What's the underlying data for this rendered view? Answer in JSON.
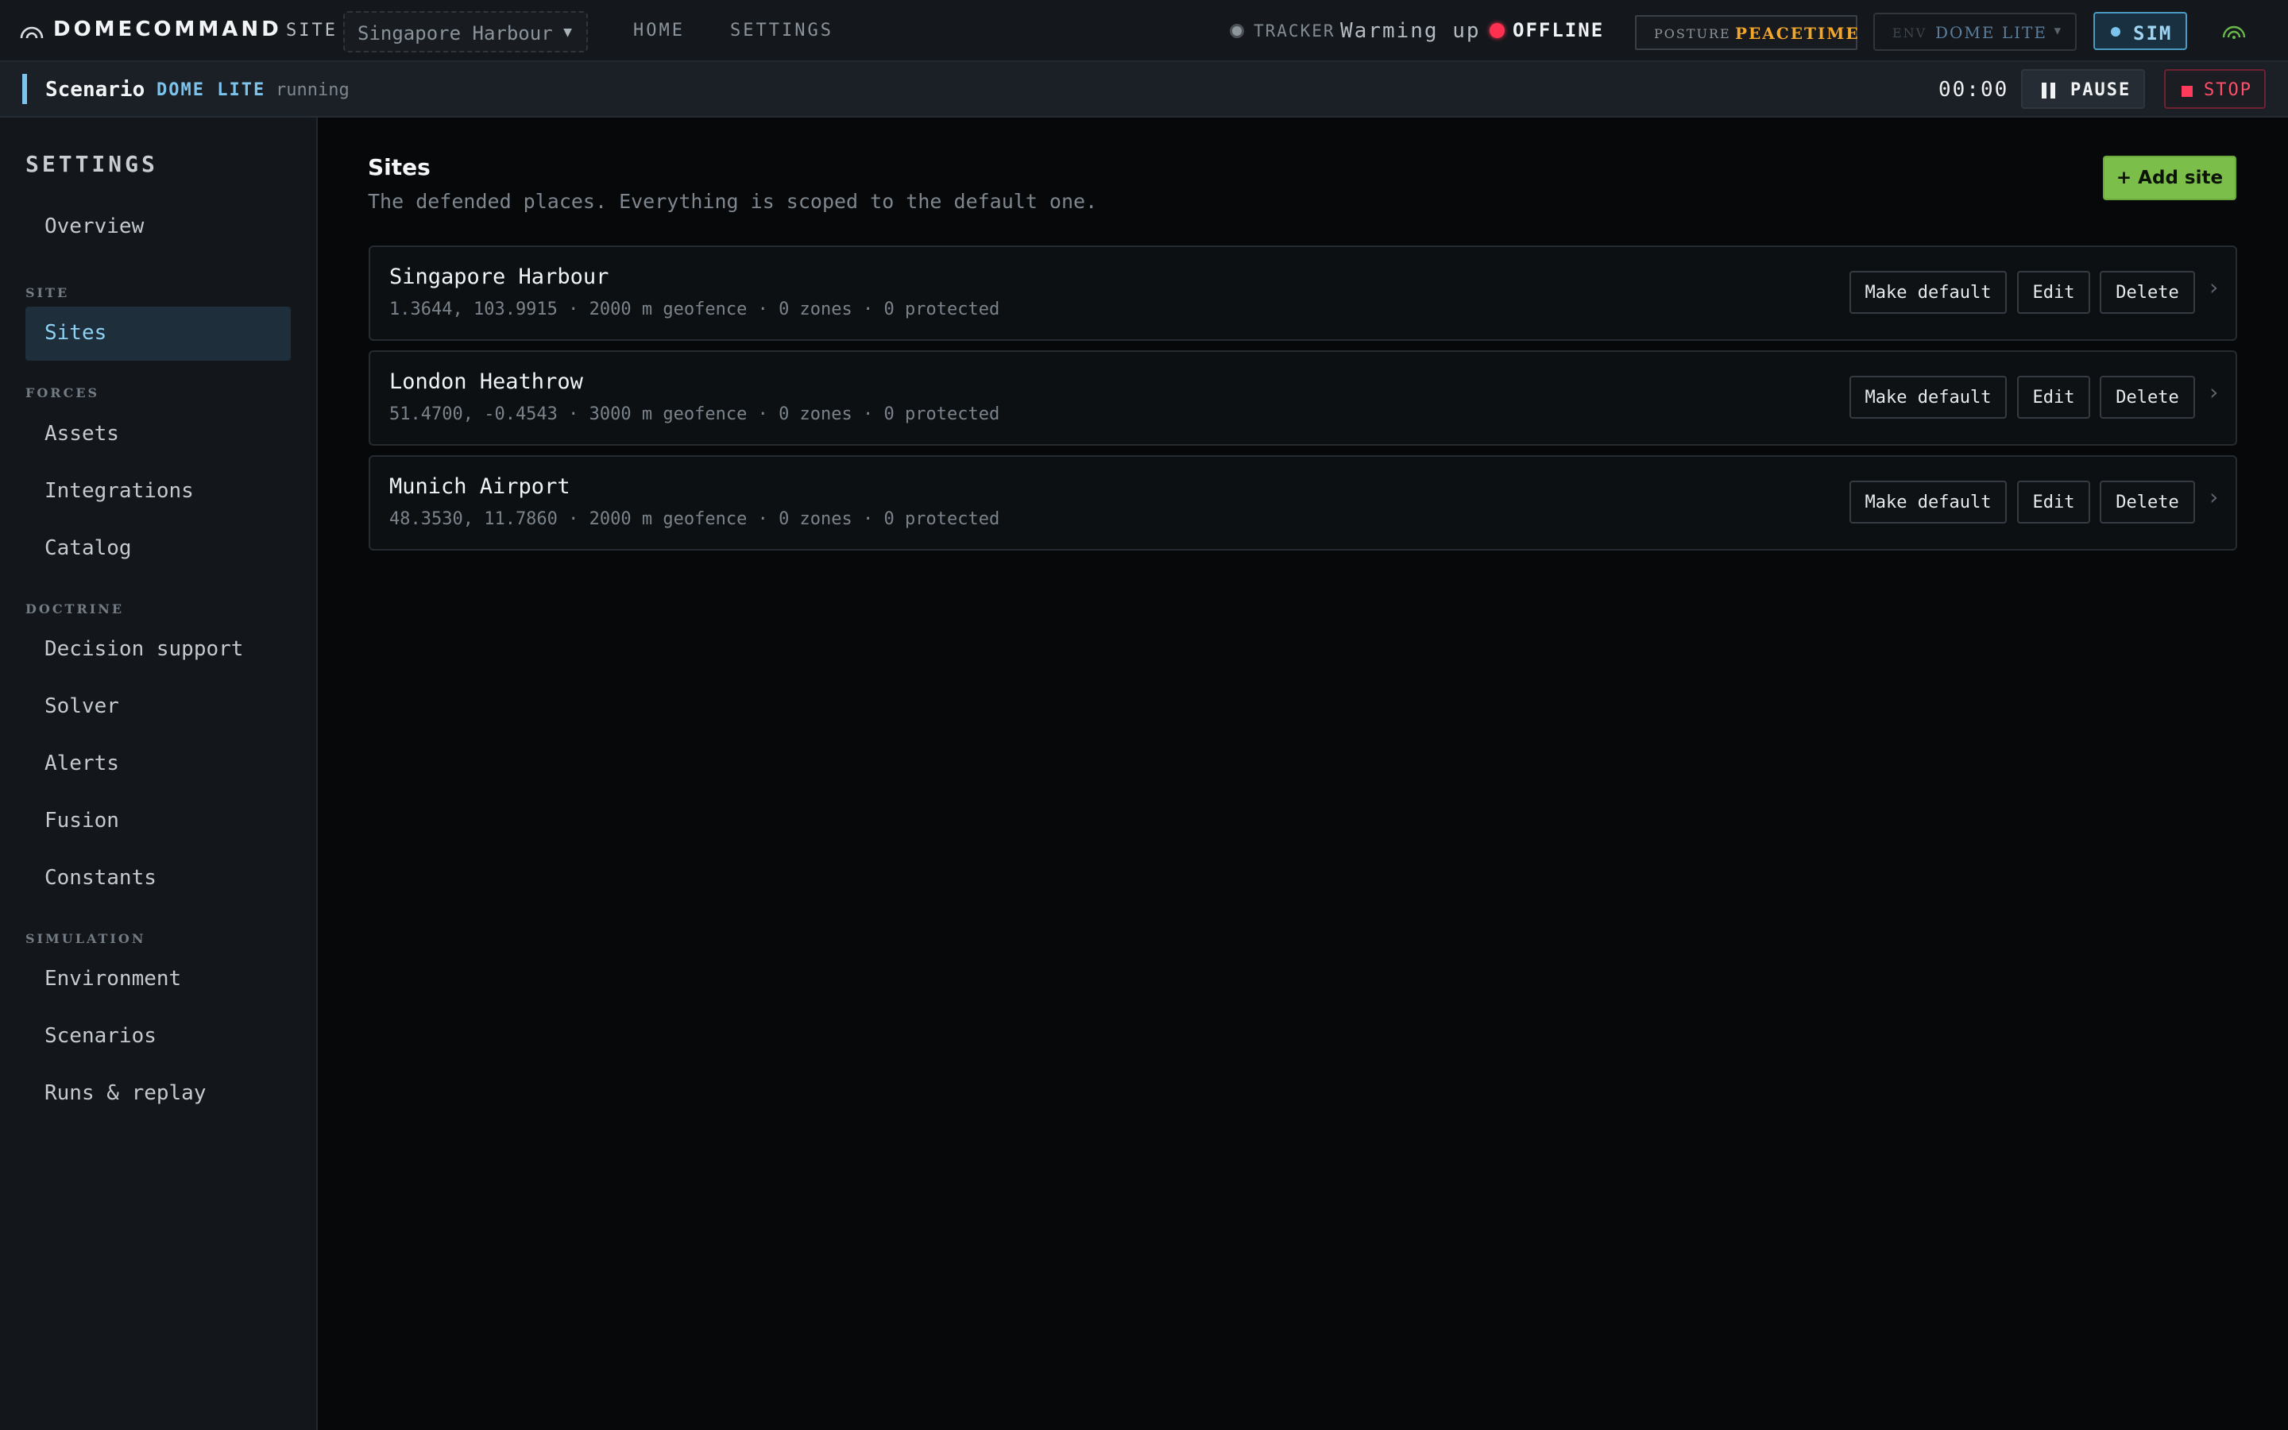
{
  "app": {
    "name": "DOMECOMMAND"
  },
  "topbar": {
    "site_label": "SITE",
    "site_select": {
      "value": "Singapore Harbour"
    },
    "nav": [
      "HOME",
      "SETTINGS"
    ],
    "tracker": {
      "label": "TRACKER",
      "status": "Warming up"
    },
    "connection": {
      "label": "OFFLINE",
      "color": "#ff3050"
    },
    "posture": {
      "label": "POSTURE",
      "value": "PEACETIME",
      "color": "#f2a72b"
    },
    "env": {
      "label": "ENV",
      "value": "DOME LITE"
    },
    "sim": {
      "label": "SIM",
      "color": "#7cc4ee"
    }
  },
  "scenario": {
    "title": "Scenario",
    "env": "DOME LITE",
    "state": "running",
    "timer": "00:00",
    "pause_label": "PAUSE",
    "stop_label": "STOP"
  },
  "sidebar": {
    "title": "SETTINGS",
    "overview": "Overview",
    "groups": {
      "site": {
        "label": "SITE",
        "items": [
          "Sites"
        ]
      },
      "forces": {
        "label": "FORCES",
        "items": [
          "Assets",
          "Integrations",
          "Catalog"
        ]
      },
      "doctrine": {
        "label": "DOCTRINE",
        "items": [
          "Decision support",
          "Solver",
          "Alerts",
          "Fusion",
          "Constants"
        ]
      },
      "simulation": {
        "label": "SIMULATION",
        "items": [
          "Environment",
          "Scenarios",
          "Runs & replay"
        ]
      }
    },
    "active": "Sites"
  },
  "main": {
    "title": "Sites",
    "subtitle": "The defended places. Everything is scoped to the default one.",
    "add_label": "+ Add site",
    "actions": {
      "make_default": "Make default",
      "edit": "Edit",
      "delete": "Delete"
    },
    "sites": [
      {
        "name": "Singapore Harbour",
        "meta": "1.3644, 103.9915 · 2000 m geofence · 0 zones · 0 protected"
      },
      {
        "name": "London Heathrow",
        "meta": "51.4700, -0.4543 · 3000 m geofence · 0 zones · 0 protected"
      },
      {
        "name": "Munich Airport",
        "meta": "48.3530, 11.7860 · 2000 m geofence · 0 zones · 0 protected"
      }
    ]
  },
  "colors": {
    "accent": "#7cc4ee",
    "add": "#7bbf4a",
    "danger": "#ff3b5b"
  }
}
